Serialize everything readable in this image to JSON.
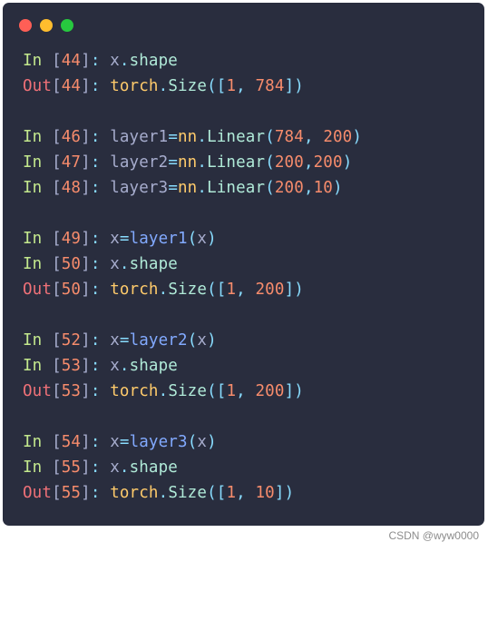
{
  "lines": [
    {
      "in": 44,
      "code": "x.shape"
    },
    {
      "out": 44,
      "code": "torch.Size([1, 784])"
    },
    null,
    {
      "in": 46,
      "code": "layer1=nn.Linear(784, 200)"
    },
    {
      "in": 47,
      "code": "layer2=nn.Linear(200,200)"
    },
    {
      "in": 48,
      "code": "layer3=nn.Linear(200,10)"
    },
    null,
    {
      "in": 49,
      "code": "x=layer1(x)"
    },
    {
      "in": 50,
      "code": "x.shape"
    },
    {
      "out": 50,
      "code": "torch.Size([1, 200])"
    },
    null,
    {
      "in": 52,
      "code": "x=layer2(x)"
    },
    {
      "in": 53,
      "code": "x.shape"
    },
    {
      "out": 53,
      "code": "torch.Size([1, 200])"
    },
    null,
    {
      "in": 54,
      "code": "x=layer3(x)"
    },
    {
      "in": 55,
      "code": "x.shape"
    },
    {
      "out": 55,
      "code": "torch.Size([1, 10])"
    }
  ],
  "in_label": "In",
  "out_label": "Out",
  "watermark": "CSDN @wyw0000"
}
